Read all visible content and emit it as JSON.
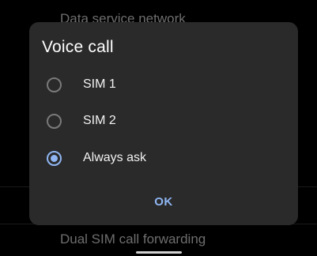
{
  "background": {
    "top_item": "Data service network",
    "bottom_item": "Dual SIM call forwarding"
  },
  "dialog": {
    "title": "Voice call",
    "options": [
      {
        "label": "SIM 1",
        "checked": false
      },
      {
        "label": "SIM 2",
        "checked": false
      },
      {
        "label": "Always ask",
        "checked": true
      }
    ],
    "ok_label": "OK"
  },
  "colors": {
    "dialog_bg": "#2a2a2b",
    "accent": "#8fb6f2",
    "radio_unchecked": "#7a7a7a"
  }
}
